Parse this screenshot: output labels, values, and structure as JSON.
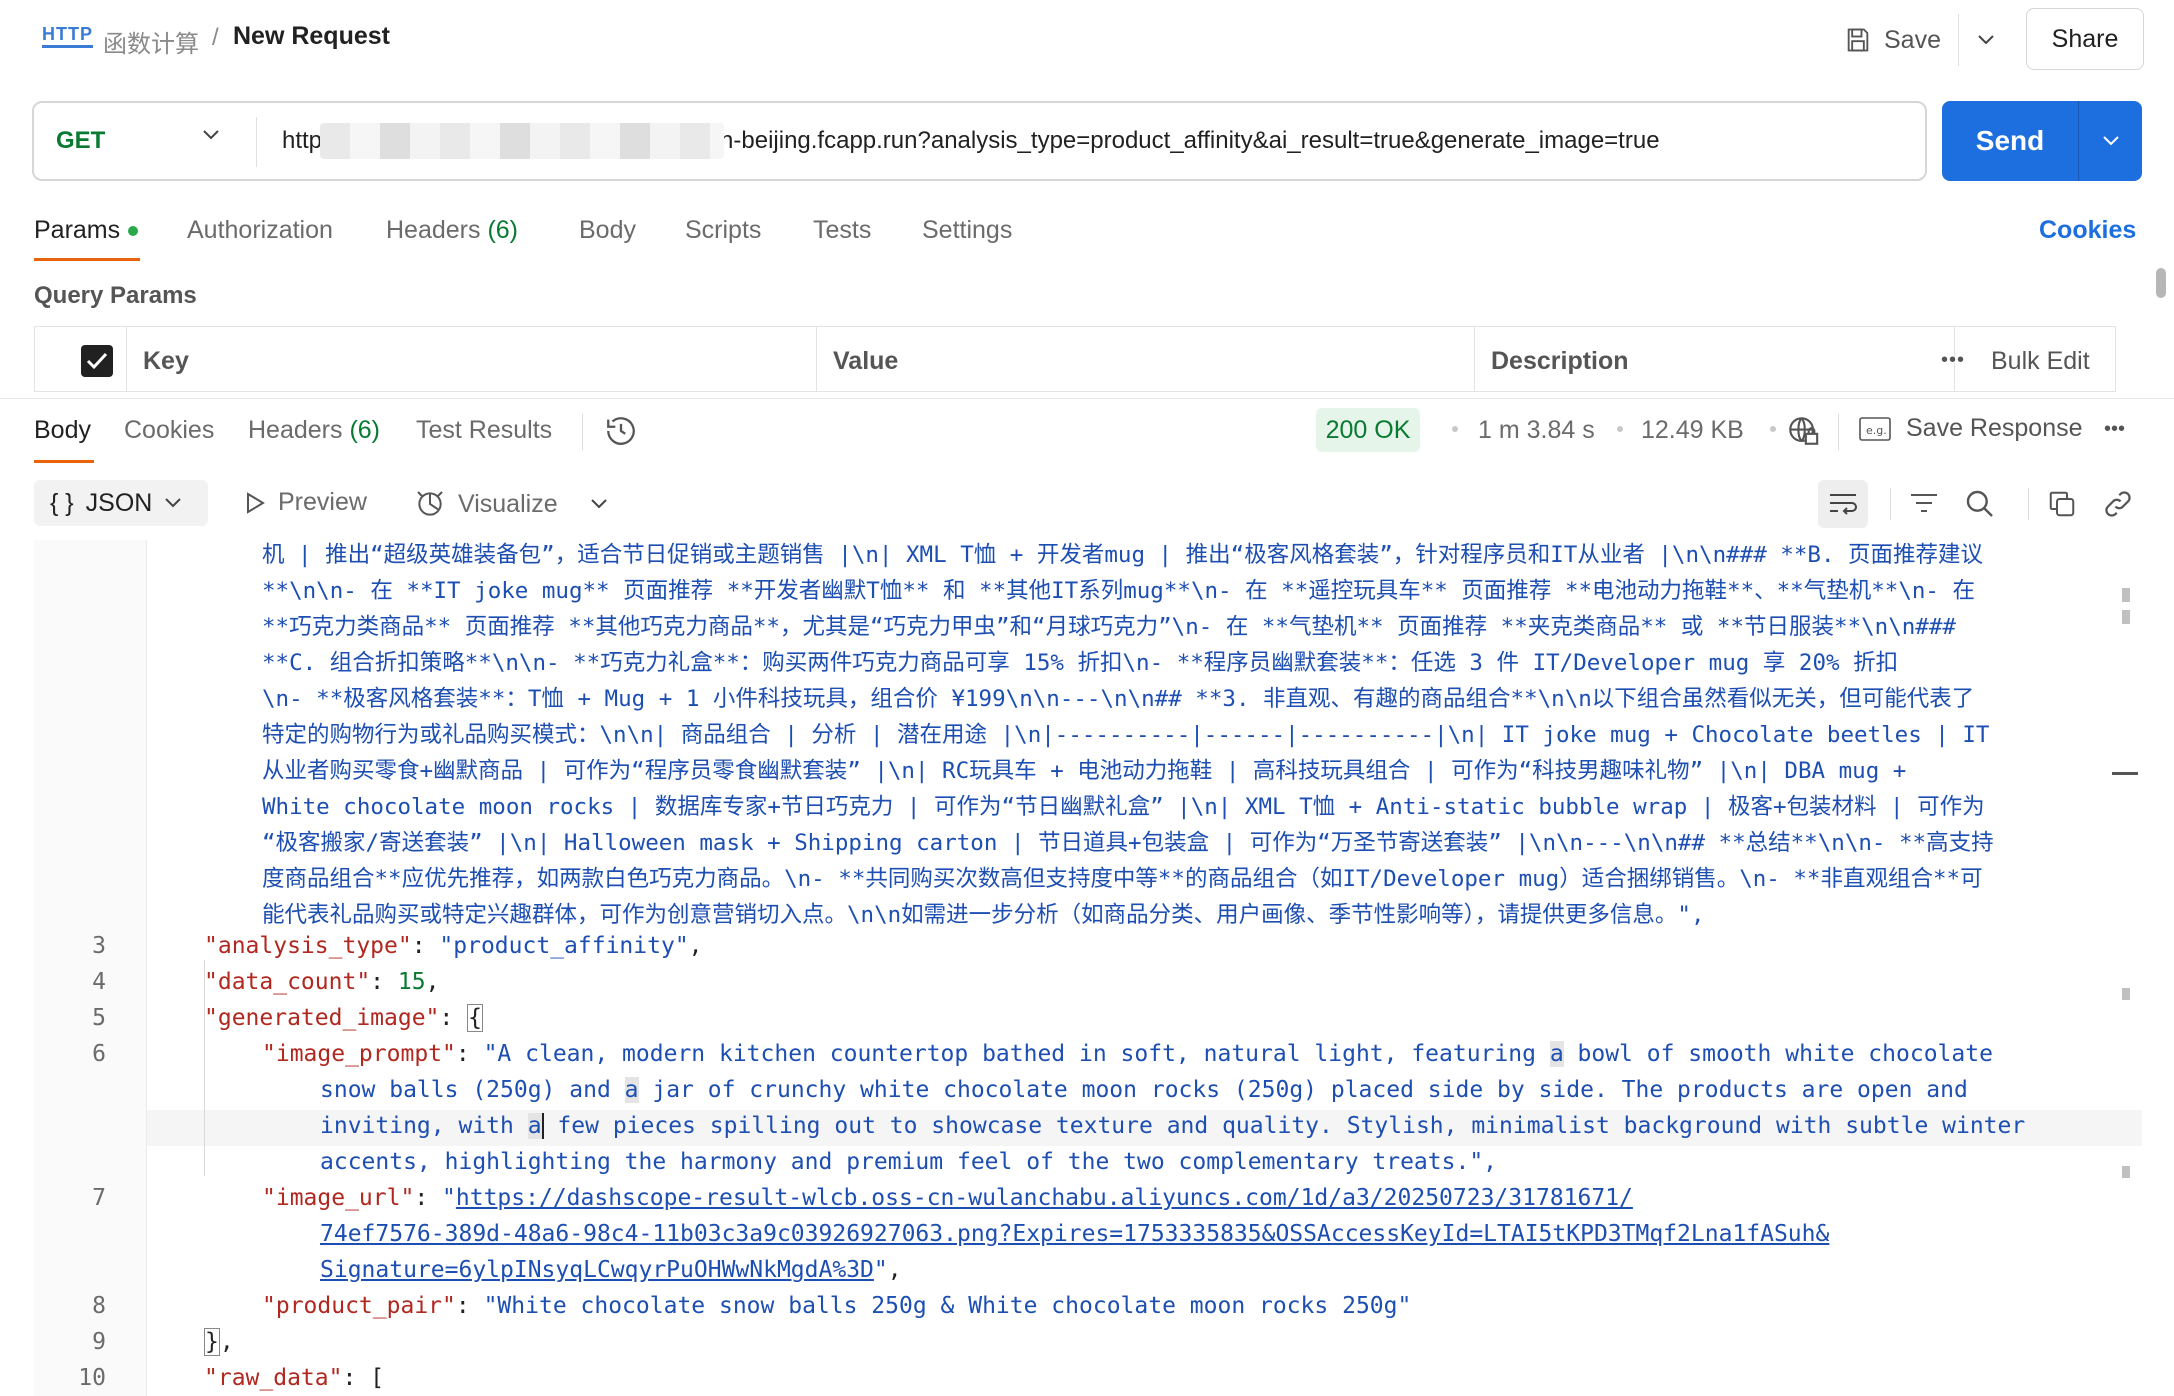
{
  "header": {
    "protocol_badge": "HTTP",
    "breadcrumb_parent": "函数计算",
    "breadcrumb_separator": "/",
    "title": "New Request",
    "save_label": "Save",
    "share_label": "Share"
  },
  "request": {
    "method": "GET",
    "url_prefix": "http",
    "url_suffix": "cn-beijing.fcapp.run?analysis_type=product_affinity&ai_result=true&generate_image=true",
    "send_label": "Send"
  },
  "request_tabs": {
    "params": "Params",
    "authorization": "Authorization",
    "headers": "Headers",
    "headers_count": "(6)",
    "body": "Body",
    "scripts": "Scripts",
    "tests": "Tests",
    "settings": "Settings",
    "cookies": "Cookies"
  },
  "query_params": {
    "title": "Query Params",
    "col_key": "Key",
    "col_value": "Value",
    "col_description": "Description",
    "bulk_edit": "Bulk Edit"
  },
  "response_tabs": {
    "body": "Body",
    "cookies": "Cookies",
    "headers": "Headers",
    "headers_count": "(6)",
    "test_results": "Test Results"
  },
  "response_meta": {
    "status": "200 OK",
    "time": "1 m 3.84 s",
    "size": "12.49 KB",
    "save_response": "Save Response"
  },
  "toolbar": {
    "format": "JSON",
    "format_braces": "{ }",
    "preview": "Preview",
    "visualize": "Visualize"
  },
  "code": {
    "wrapped": [
      "机 | 推出“超级英雄装备包”，适合节日促销或主题销售 |\\n| XML T恤 + 开发者mug | 推出“极客风格套装”，针对程序员和IT从业者 |\\n\\n### **B. 页面推荐建议",
      "**\\n\\n- 在 **IT joke mug** 页面推荐 **开发者幽默T恤** 和 **其他IT系列mug**\\n- 在 **遥控玩具车** 页面推荐 **电池动力拖鞋**、**气垫机**\\n- 在",
      "**巧克力类商品** 页面推荐 **其他巧克力商品**，尤其是“巧克力甲虫”和“月球巧克力”\\n- 在 **气垫机** 页面推荐 **夹克类商品** 或 **节日服装**\\n\\n###",
      "**C. 组合折扣策略**\\n\\n- **巧克力礼盒**：购买两件巧克力商品可享 15% 折扣\\n- **程序员幽默套装**：任选 3 件 IT/Developer mug 享 20% 折扣",
      "\\n- **极客风格套装**：T恤 + Mug + 1 小件科技玩具，组合价 ¥199\\n\\n---\\n\\n## **3. 非直观、有趣的商品组合**\\n\\n以下组合虽然看似无关，但可能代表了",
      "特定的购物行为或礼品购买模式：\\n\\n| 商品组合 | 分析 | 潜在用途 |\\n|----------|------|----------|\\n| IT joke mug + Chocolate beetles | IT",
      "从业者购买零食+幽默商品 | 可作为“程序员零食幽默套装” |\\n| RC玩具车 + 电池动力拖鞋 | 高科技玩具组合 | 可作为“科技男趣味礼物” |\\n| DBA mug +",
      "White chocolate moon rocks | 数据库专家+节日巧克力 | 可作为“节日幽默礼盒” |\\n| XML T恤 + Anti-static bubble wrap | 极客+包装材料 | 可作为",
      "“极客搬家/寄送套装” |\\n| Halloween mask + Shipping carton | 节日道具+包装盒 | 可作为“万圣节寄送套装” |\\n\\n---\\n\\n## **总结**\\n\\n- **高支持",
      "度商品组合**应优先推荐，如两款白色巧克力商品。\\n- **共同购买次数高但支持度中等**的商品组合（如IT/Developer mug）适合捆绑销售。\\n- **非直观组合**可",
      "能代表礼品购买或特定兴趣群体，可作为创意营销切入点。\\n\\n如需进一步分析（如商品分类、用户画像、季节性影响等），请提供更多信息。\","
    ],
    "line_numbers": [
      "3",
      "4",
      "5",
      "6",
      "7",
      "8",
      "9",
      "10"
    ],
    "k_analysis_type": "\"analysis_type\"",
    "v_analysis_type": "\"product_affinity\"",
    "k_data_count": "\"data_count\"",
    "v_data_count": "15",
    "k_generated_image": "\"generated_image\"",
    "open_brace": "{",
    "k_image_prompt": "\"image_prompt\"",
    "prompt_l1a": "\"A clean, modern kitchen countertop bathed in soft, natural light, featuring ",
    "prompt_a": "a",
    "prompt_l1b": " bowl of smooth white chocolate",
    "prompt_l2a": "snow balls (250g) and ",
    "prompt_l2b": " jar of crunchy white chocolate moon rocks (250g) placed side by side. The products are open and",
    "prompt_l3a": "inviting, with ",
    "prompt_l3b": " few pieces spilling out to showcase texture and quality. Stylish, minimalist background with subtle winter",
    "prompt_l4": "accents, highlighting the harmony and premium feel of the two complementary treats.\",",
    "k_image_url": "\"image_url\"",
    "url_l1": "https://dashscope-result-wlcb.oss-cn-wulanchabu.aliyuncs.com/1d/a3/20250723/31781671/",
    "url_l2": "74ef7576-389d-48a6-98c4-11b03c3a9c03926927063.png?Expires=1753335835&OSSAccessKeyId=LTAI5tKPD3TMqf2Lna1fASuh&",
    "url_l3": "Signature=6ylpINsyqLCwqyrPuOHWwNkMgdA%3D",
    "k_product_pair": "\"product_pair\"",
    "v_product_pair": "\"White chocolate snow balls 250g & White chocolate moon rocks 250g\"",
    "close_brace": "}",
    "k_raw_data": "\"raw_data\"",
    "open_bracket": "["
  },
  "colors": {
    "accent": "#1d6fe0",
    "tab_underline": "#e8630a",
    "status_ok": "#0a7a32",
    "json_key": "#b0281f",
    "json_string": "#1d4eb2"
  }
}
